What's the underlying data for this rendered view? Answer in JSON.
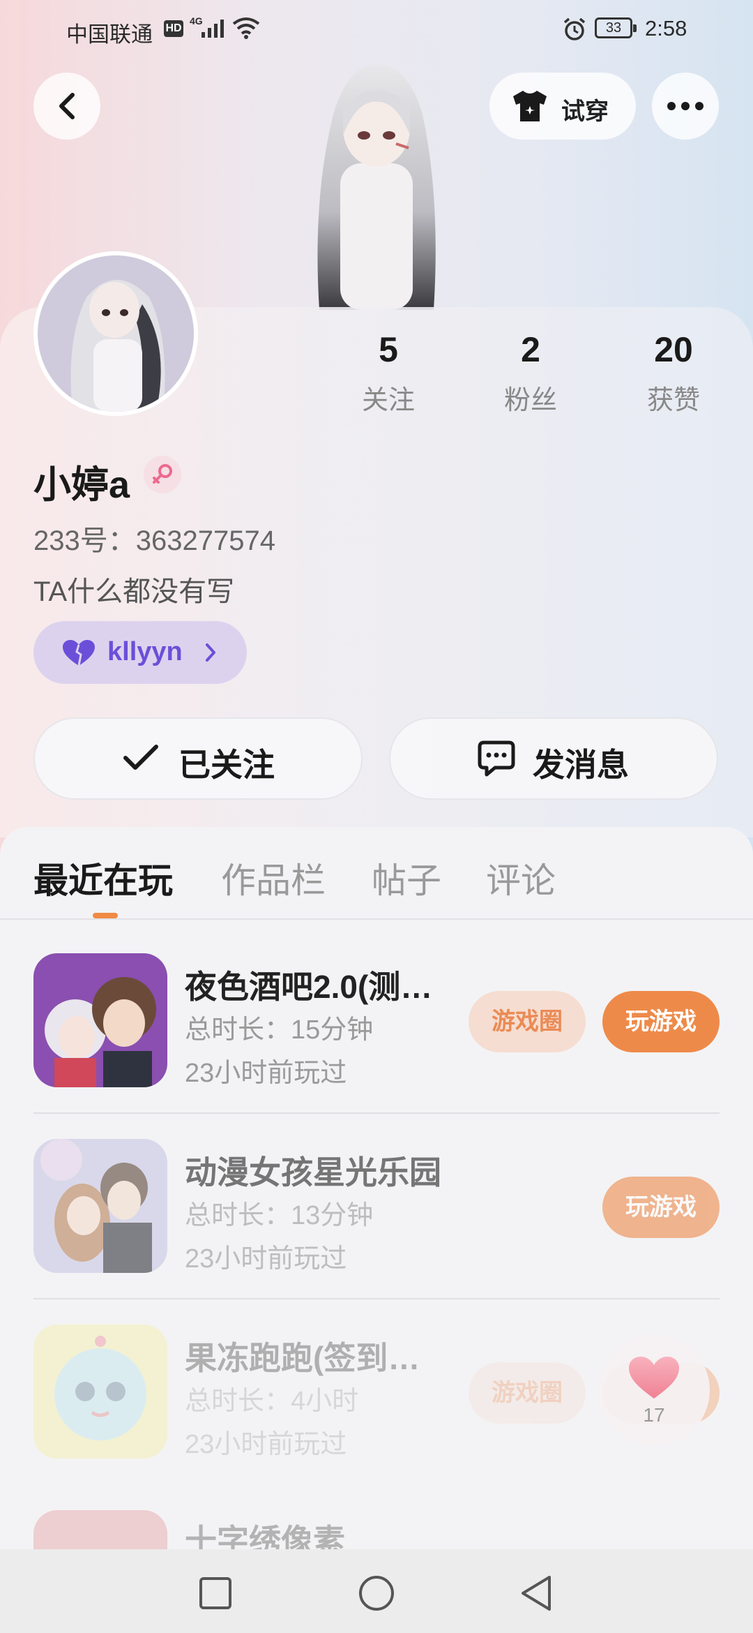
{
  "status_bar": {
    "carrier": "中国联通",
    "hd": "HD",
    "network": "4G",
    "battery": "33",
    "time": "2:58"
  },
  "header": {
    "try_on_label": "试穿"
  },
  "profile": {
    "stats": [
      {
        "value": "5",
        "label": "关注"
      },
      {
        "value": "2",
        "label": "粉丝"
      },
      {
        "value": "20",
        "label": "获赞"
      }
    ],
    "username": "小婷a",
    "uid": "233号：363277574",
    "bio": "TA什么都没有写",
    "tag": "kllyyn",
    "follow_label": "已关注",
    "message_label": "发消息"
  },
  "tabs": [
    {
      "label": "最近在玩"
    },
    {
      "label": "作品栏"
    },
    {
      "label": "帖子"
    },
    {
      "label": "评论"
    }
  ],
  "games": [
    {
      "title": "夜色酒吧2.0(测…",
      "duration": "总时长：15分钟",
      "last_played": "23小时前玩过",
      "circle_label": "游戏圈",
      "play_label": "玩游戏"
    },
    {
      "title": "动漫女孩星光乐园",
      "duration": "总时长：13分钟",
      "last_played": "23小时前玩过",
      "play_label": "玩游戏"
    },
    {
      "title": "果冻跑跑(签到…",
      "duration": "总时长：4小时",
      "last_played": "23小时前玩过",
      "circle_label": "游戏圈"
    },
    {
      "title": "十字绣像素"
    }
  ],
  "like_count": "17",
  "colors": {
    "accent_orange": "#ee8a49",
    "tag_purple": "#6b4fd8"
  }
}
